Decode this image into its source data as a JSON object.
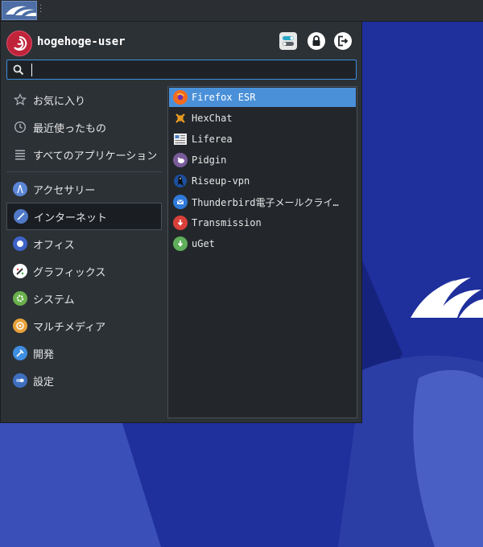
{
  "user": {
    "name": "hogehoge-user"
  },
  "search": {
    "value": "",
    "placeholder": ""
  },
  "categories": [
    {
      "label": "お気に入り",
      "icon": "star-icon"
    },
    {
      "label": "最近使ったもの",
      "icon": "clock-icon"
    },
    {
      "label": "すべてのアプリケーション",
      "icon": "list-icon"
    },
    {
      "label": "アクセサリー",
      "icon": "accessories-icon"
    },
    {
      "label": "インターネット",
      "icon": "internet-icon",
      "selected": true
    },
    {
      "label": "オフィス",
      "icon": "office-icon"
    },
    {
      "label": "グラフィックス",
      "icon": "graphics-icon"
    },
    {
      "label": "システム",
      "icon": "system-icon"
    },
    {
      "label": "マルチメディア",
      "icon": "multimedia-icon"
    },
    {
      "label": "開発",
      "icon": "development-icon"
    },
    {
      "label": "設定",
      "icon": "settings-icon"
    }
  ],
  "apps": [
    {
      "label": "Firefox ESR",
      "icon": "firefox-icon",
      "selected": true
    },
    {
      "label": "HexChat",
      "icon": "hexchat-icon"
    },
    {
      "label": "Liferea",
      "icon": "liferea-icon"
    },
    {
      "label": "Pidgin",
      "icon": "pidgin-icon"
    },
    {
      "label": "Riseup-vpn",
      "icon": "riseup-vpn-icon"
    },
    {
      "label": "Thunderbird電子メールクライ…",
      "icon": "thunderbird-icon"
    },
    {
      "label": "Transmission",
      "icon": "transmission-icon"
    },
    {
      "label": "uGet",
      "icon": "uget-icon"
    }
  ],
  "colors": {
    "accent": "#4a90d9",
    "menu_bg": "#2c3136",
    "desktop_bg": "#1f2f9c"
  }
}
